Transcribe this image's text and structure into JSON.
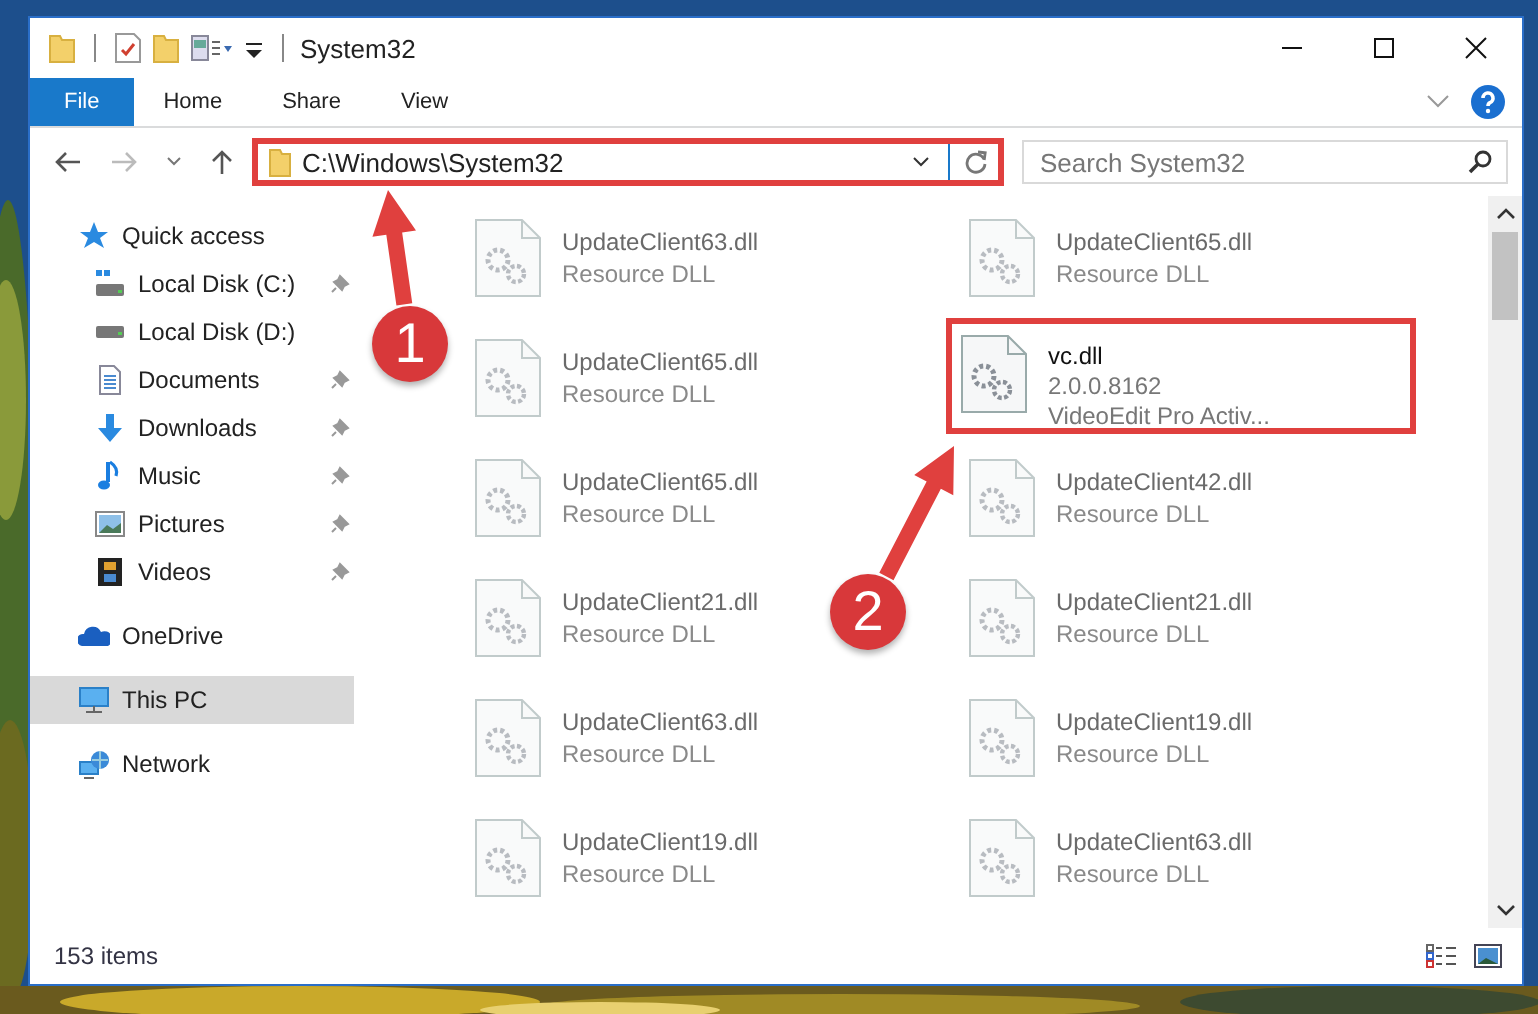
{
  "window": {
    "title": "System32"
  },
  "ribbon": {
    "tabs": [
      {
        "label": "File",
        "selected": true
      },
      {
        "label": "Home",
        "selected": false
      },
      {
        "label": "Share",
        "selected": false
      },
      {
        "label": "View",
        "selected": false
      }
    ]
  },
  "address_bar": {
    "path": "C:\\Windows\\System32",
    "highlighted": true
  },
  "search": {
    "placeholder": "Search System32"
  },
  "sidebar": {
    "items": [
      {
        "label": "Quick access",
        "kind": "star",
        "selected": false
      },
      {
        "label": "Local Disk (C:)",
        "kind": "drive-c",
        "pinned": true,
        "selected": false
      },
      {
        "label": "Local Disk (D:)",
        "kind": "drive",
        "pinned": false,
        "selected": false
      },
      {
        "label": "Documents",
        "kind": "documents",
        "pinned": true,
        "selected": false
      },
      {
        "label": "Downloads",
        "kind": "downloads",
        "pinned": true,
        "selected": false
      },
      {
        "label": "Music",
        "kind": "music",
        "pinned": true,
        "selected": false
      },
      {
        "label": "Pictures",
        "kind": "pictures",
        "pinned": true,
        "selected": false
      },
      {
        "label": "Videos",
        "kind": "videos",
        "pinned": true,
        "selected": false
      },
      {
        "label": "OneDrive",
        "kind": "cloud",
        "selected": false
      },
      {
        "label": "This PC",
        "kind": "pc",
        "selected": true
      },
      {
        "label": "Network",
        "kind": "network",
        "selected": false
      }
    ]
  },
  "files": [
    {
      "name": "UpdateClient63.dll",
      "details": [
        "Resource DLL"
      ],
      "dimmed": true,
      "highlighted": false
    },
    {
      "name": "UpdateClient65.dll",
      "details": [
        "Resource DLL"
      ],
      "dimmed": true,
      "highlighted": false
    },
    {
      "name": "UpdateClient65.dll",
      "details": [
        "Resource DLL"
      ],
      "dimmed": true,
      "highlighted": false
    },
    {
      "name": "vc.dll",
      "details": [
        "2.0.0.8162",
        "VideoEdit Pro Activ..."
      ],
      "dimmed": false,
      "highlighted": true
    },
    {
      "name": "UpdateClient65.dll",
      "details": [
        "Resource DLL"
      ],
      "dimmed": true,
      "highlighted": false
    },
    {
      "name": "UpdateClient42.dll",
      "details": [
        "Resource DLL"
      ],
      "dimmed": true,
      "highlighted": false
    },
    {
      "name": "UpdateClient21.dll",
      "details": [
        "Resource DLL"
      ],
      "dimmed": true,
      "highlighted": false
    },
    {
      "name": "UpdateClient21.dll",
      "details": [
        "Resource DLL"
      ],
      "dimmed": true,
      "highlighted": false
    },
    {
      "name": "UpdateClient63.dll",
      "details": [
        "Resource DLL"
      ],
      "dimmed": true,
      "highlighted": false
    },
    {
      "name": "UpdateClient19.dll",
      "details": [
        "Resource DLL"
      ],
      "dimmed": true,
      "highlighted": false
    },
    {
      "name": "UpdateClient19.dll",
      "details": [
        "Resource DLL"
      ],
      "dimmed": true,
      "highlighted": false
    },
    {
      "name": "UpdateClient63.dll",
      "details": [
        "Resource DLL"
      ],
      "dimmed": true,
      "highlighted": false
    }
  ],
  "status_bar": {
    "item_count": "153 items"
  },
  "annotations": [
    {
      "number": "1"
    },
    {
      "number": "2"
    }
  ]
}
